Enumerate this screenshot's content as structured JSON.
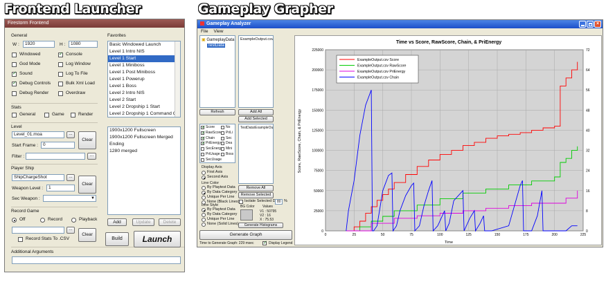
{
  "headings": {
    "launcher": "Frontend Launcher",
    "grapher": "Gameplay Grapher"
  },
  "launcher": {
    "title": "Firestorm Frontend",
    "general_label": "General",
    "w_label": "W :",
    "w_value": "1920",
    "h_label": "H :",
    "h_value": "1080",
    "checks": [
      {
        "label": "Windowed",
        "checked": false
      },
      {
        "label": "Console",
        "checked": true
      },
      {
        "label": "God Mode",
        "checked": false
      },
      {
        "label": "Log Window",
        "checked": false
      },
      {
        "label": "Sound",
        "checked": true
      },
      {
        "label": "Log To File",
        "checked": false
      },
      {
        "label": "Debug Controls",
        "checked": true
      },
      {
        "label": "Bulk Xml Load",
        "checked": false
      },
      {
        "label": "Debug Render",
        "checked": false
      },
      {
        "label": "Overdraw",
        "checked": false
      }
    ],
    "stats_label": "Stats",
    "stats": [
      "General",
      "Game",
      "Render"
    ],
    "level_label": "Level",
    "level_value": "Level_01.moa",
    "start_frame_label": "Start Frame :",
    "start_frame_value": "0",
    "filter_label": "Filter :",
    "clear_label": "Clear",
    "browse_label": "...",
    "player_ship_label": "Player Ship",
    "ship_value": "ShipChargeShot",
    "weapon_level_label": "Weapon Level :",
    "weapon_level_value": "1",
    "sec_weapon_label": "Sec Weapon :",
    "record_game_label": "Record Game",
    "record_options": [
      "Off",
      "Record",
      "Playback"
    ],
    "record_stats_label": "Record Stats To .CSV",
    "additional_args_label": "Additional Arguments",
    "favorites_label": "Favorites",
    "favorites": [
      "Basic Windowed Launch",
      "Level 1 Intro NIS",
      "Level 1 Start",
      "Level 1 Miniboss",
      "Level 1 Post Miniboss",
      "Level 1 Powerup",
      "Level 1 Boss",
      "Level 2 Intro NIS",
      "Level 2 Start",
      "Level 2 Dropship 1 Start",
      "Level 2 Dropship 1 Command C"
    ],
    "favorites_selected": 2,
    "favorite_details": [
      "1900x1200 Fullscreen",
      "1900x1200 Fullscreen Merged",
      "Ending",
      "1280 merged"
    ],
    "add_label": "Add",
    "update_label": "Update",
    "delete_label": "Delete",
    "build_label": "Build",
    "launch_label": "Launch"
  },
  "grapher": {
    "title": "Gameplay Analyzer",
    "menu": [
      "File",
      "View"
    ],
    "tree": [
      "GameplayData",
      "TestData"
    ],
    "files": [
      "ExampleOutput.csv"
    ],
    "refresh_label": "Refresh",
    "add_all_label": "Add All",
    "add_selected_label": "Add Selected",
    "selected_files": [
      "TestData\\ExampleOutput.csv"
    ],
    "columns_left": [
      {
        "label": "Score",
        "checked": true
      },
      {
        "label": "RawScore",
        "checked": true
      },
      {
        "label": "Chain",
        "checked": true
      },
      {
        "label": "PriEnergy",
        "checked": true
      },
      {
        "label": "SecEnergy",
        "checked": false
      },
      {
        "label": "PriUsage",
        "checked": false
      },
      {
        "label": "SecUsage",
        "checked": false
      }
    ],
    "columns_right": [
      "No",
      "PriLi",
      "Sec",
      "Dea",
      "Mini",
      "Boss"
    ],
    "display_axis_label": "Display Axis",
    "axis_options": [
      "First Axis",
      "Second Axis"
    ],
    "line_color_label": "Line Color",
    "color_options": [
      "By Playtest Data",
      "By Data Category",
      "Unique Per Line",
      "None (Black Lines)"
    ],
    "line_style_label": "Line Style",
    "style_options": [
      "By Playtest Data",
      "By Data Category",
      "Unique Per Line",
      "None (Solid Lines)"
    ],
    "remove_all_label": "Remove All",
    "remove_selected_label": "Remove Selected",
    "isolate_label": "Isolate Selected Data",
    "isolate_value": "80",
    "isolate_unit": "%",
    "bg_color_label": "BG Color",
    "values_label": "Values",
    "value_v1": "V1 : 50795",
    "value_v2": "V2 : 16",
    "value_x": "X : 75.53",
    "generate_histograms_label": "Generate Histograms",
    "generate_graph_label": "Generate Graph",
    "status_text": "Time to Generate Graph: 229 msec",
    "display_legend_label": "Display Legend",
    "accent_colors": {
      "score": "#ff0000",
      "rawscore": "#00cc00",
      "prienergy": "#dd00dd",
      "chain": "#0000ff"
    }
  },
  "chart_data": {
    "type": "line",
    "title": "Time vs Score, RawScore, Chain, & PriEnergy",
    "xlabel": "Time",
    "ylabel": "Score, RawScore, Chain, & PriEnergy",
    "xlim": [
      0,
      225
    ],
    "ylim": [
      0,
      225000
    ],
    "y2lim": [
      0,
      72
    ],
    "x_ticks": [
      0,
      25,
      50,
      75,
      100,
      125,
      150,
      175,
      200,
      225
    ],
    "y_ticks": [
      0,
      25000,
      50000,
      75000,
      100000,
      125000,
      150000,
      175000,
      200000,
      225000
    ],
    "y2_ticks": [
      0,
      8,
      16,
      24,
      32,
      40,
      48,
      56,
      64,
      72
    ],
    "legend_position": "top-left",
    "grid": true,
    "series": [
      {
        "name": "ExampleOutput.csv Score",
        "axis": "left",
        "x": [
          18,
          25,
          30,
          35,
          40,
          45,
          50,
          55,
          60,
          70,
          80,
          90,
          100,
          110,
          120,
          130,
          140,
          150,
          160,
          170,
          180,
          190,
          200,
          205,
          210,
          215,
          220
        ],
        "values": [
          0,
          5000,
          12000,
          22000,
          30000,
          38000,
          45000,
          52000,
          60000,
          70000,
          80000,
          88000,
          95000,
          100000,
          106000,
          110000,
          115000,
          118000,
          120000,
          122000,
          125000,
          128000,
          130000,
          180000,
          190000,
          200000,
          210000
        ]
      },
      {
        "name": "ExampleOutput.csv RawScore",
        "axis": "left",
        "x": [
          18,
          30,
          40,
          50,
          60,
          80,
          100,
          120,
          140,
          160,
          180,
          200,
          205,
          210,
          215,
          220
        ],
        "values": [
          0,
          5000,
          12000,
          18000,
          25000,
          32000,
          40000,
          47000,
          52000,
          57000,
          62000,
          67000,
          85000,
          90000,
          100000,
          105000
        ]
      },
      {
        "name": "ExampleOutput.csv PriEnergy",
        "axis": "right",
        "x": [
          18,
          40,
          60,
          80,
          100,
          120,
          140,
          160,
          180,
          200,
          210,
          220
        ],
        "values": [
          0,
          3,
          5,
          6,
          7,
          8,
          9,
          10,
          11,
          11,
          13,
          16
        ]
      },
      {
        "name": "ExampleOutput.csv Chain",
        "axis": "right",
        "x": [
          18,
          20,
          25,
          30,
          35,
          40,
          41,
          42,
          45,
          50,
          55,
          58,
          59,
          62,
          65,
          70,
          75,
          77,
          78,
          82,
          86,
          90,
          93,
          94,
          98,
          102,
          104,
          105,
          108,
          112,
          118,
          120,
          121,
          126,
          130,
          131,
          135,
          138,
          139,
          145,
          160,
          165,
          170,
          172,
          173,
          180,
          185,
          189,
          190,
          195,
          200,
          205,
          210,
          215,
          220
        ],
        "values": [
          0,
          8,
          20,
          38,
          50,
          56,
          0,
          0,
          2,
          16,
          22,
          23,
          0,
          2,
          8,
          14,
          18,
          19,
          0,
          2,
          10,
          16,
          20,
          0,
          2,
          6,
          8,
          0,
          3,
          12,
          15,
          16,
          0,
          5,
          8,
          0,
          3,
          6,
          0,
          0,
          2,
          10,
          18,
          20,
          0,
          0,
          6,
          16,
          0,
          0,
          0,
          0,
          0,
          2,
          2
        ]
      }
    ]
  }
}
